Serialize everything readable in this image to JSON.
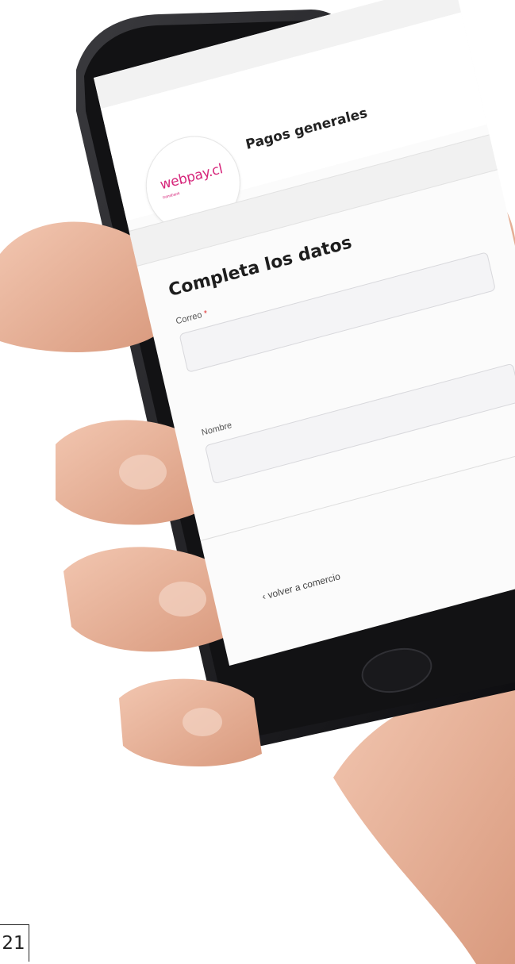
{
  "screen": {
    "logo": {
      "text": "webpay.cl",
      "subtext": "transbank"
    },
    "merchant_title": "Pagos generales",
    "form": {
      "title": "Completa los datos",
      "fields": [
        {
          "label": "Correo",
          "required_mark": "*",
          "value": ""
        },
        {
          "label": "Nombre",
          "value": ""
        }
      ],
      "back_link": "volver a comercio"
    }
  },
  "page_number": "21",
  "colors": {
    "brand": "#d6257a",
    "phone_frame": "#1a1a1c",
    "skin": "#e9b79f"
  }
}
